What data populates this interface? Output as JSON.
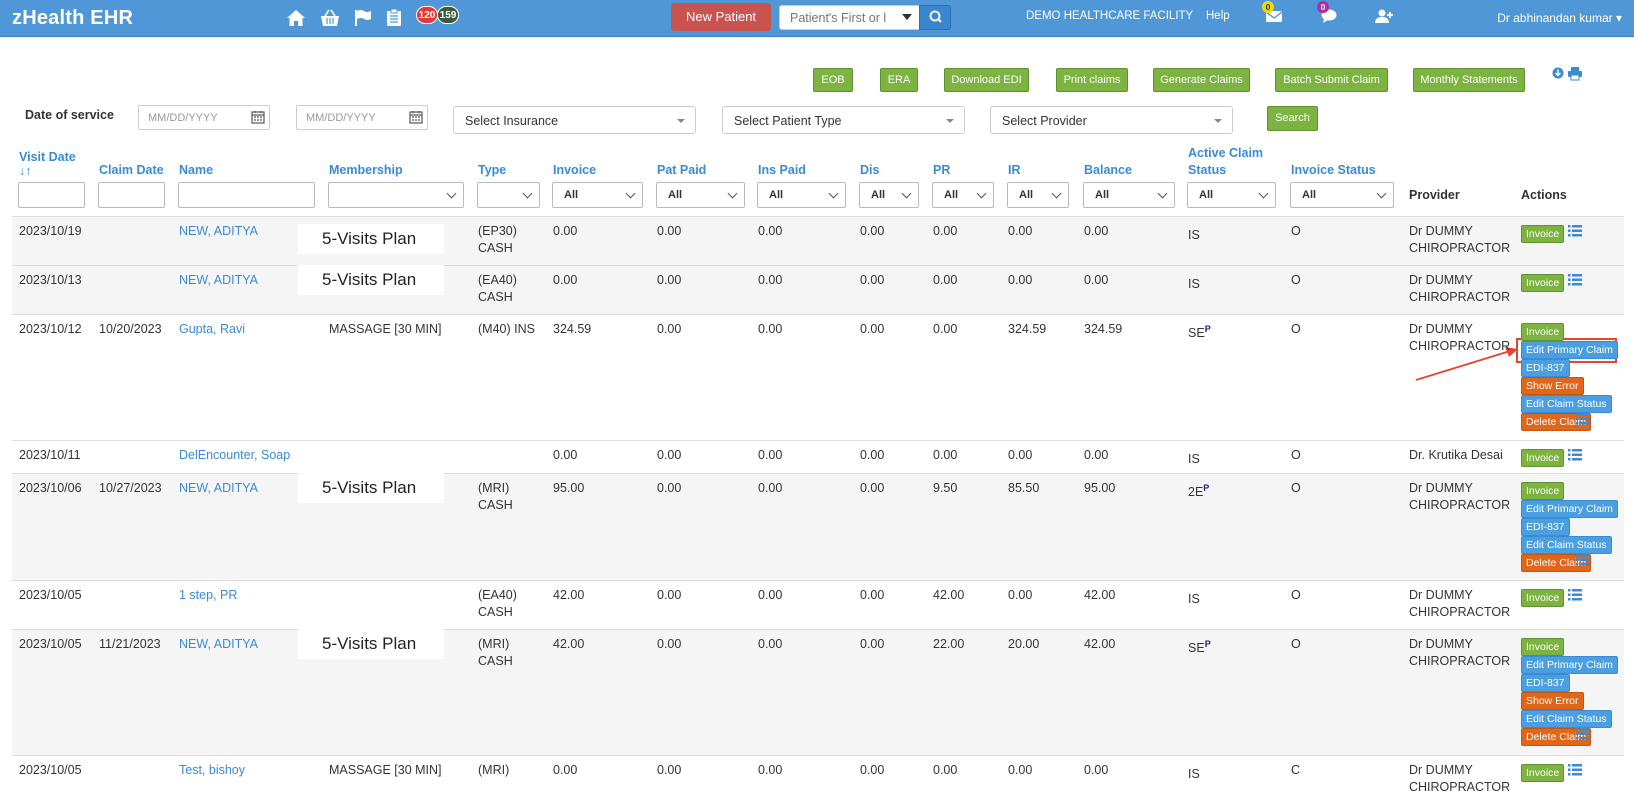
{
  "app": {
    "title": "zHealth EHR"
  },
  "nav": {
    "badges": {
      "red": "120",
      "dark": "159"
    },
    "new_patient": "New Patient",
    "search_placeholder": "Patient's First or l",
    "facility": "DEMO HEALTHCARE FACILITY",
    "help": "Help",
    "mail_count": "0",
    "chat_count": "0",
    "user": "Dr abhinandan kumar"
  },
  "toolbar": {
    "eob": "EOB",
    "era": "ERA",
    "download_edi": "Download EDI",
    "print_claims": "Print claims",
    "generate_claims": "Generate Claims",
    "batch_submit": "Batch Submit Claim",
    "monthly_statements": "Monthly Statements"
  },
  "filters": {
    "date_label": "Date of service",
    "date_placeholder": "MM/DD/YYYY",
    "insurance": "Select Insurance",
    "patient_type": "Select Patient Type",
    "provider": "Select Provider",
    "search": "Search"
  },
  "columns": {
    "visit_date": "Visit Date",
    "claim_date": "Claim Date",
    "name": "Name",
    "membership": "Membership",
    "type": "Type",
    "invoice": "Invoice",
    "pat_paid": "Pat Paid",
    "ins_paid": "Ins Paid",
    "dis": "Dis",
    "pr": "PR",
    "ir": "IR",
    "balance": "Balance",
    "active_claim_status": "Active Claim",
    "active_claim_status2": "Status",
    "invoice_status": "Invoice Status",
    "provider": "Provider",
    "actions": "Actions",
    "all": "All"
  },
  "actions": {
    "invoice": "Invoice",
    "edit_primary": "Edit Primary Claim",
    "edi": "EDI-837",
    "show_error": "Show Error",
    "edit_status": "Edit Claim Status",
    "delete": "Delete Claim"
  },
  "rows": [
    {
      "visit": "2023/10/19",
      "claim": "",
      "name": "NEW, ADITYA",
      "membership": "5-Visits Plan",
      "type1": "(EP30)",
      "type2": "CASH",
      "invoice": "0.00",
      "pat": "0.00",
      "ins": "0.00",
      "dis": "0.00",
      "pr": "0.00",
      "ir": "0.00",
      "bal": "0.00",
      "status": "IS",
      "sup": "",
      "inv_status": "O",
      "prov1": "Dr DUMMY",
      "prov2": "CHIROPRACTOR"
    },
    {
      "visit": "2023/10/13",
      "claim": "",
      "name": "NEW, ADITYA",
      "membership": "5-Visits Plan",
      "type1": "(EA40)",
      "type2": "CASH",
      "invoice": "0.00",
      "pat": "0.00",
      "ins": "0.00",
      "dis": "0.00",
      "pr": "0.00",
      "ir": "0.00",
      "bal": "0.00",
      "status": "IS",
      "sup": "",
      "inv_status": "O",
      "prov1": "Dr DUMMY",
      "prov2": "CHIROPRACTOR"
    },
    {
      "visit": "2023/10/12",
      "claim": "10/20/2023",
      "name": "Gupta, Ravi",
      "membership": "MASSAGE [30 MIN]",
      "type1": "(M40) INS",
      "type2": "",
      "invoice": "324.59",
      "pat": "0.00",
      "ins": "0.00",
      "dis": "0.00",
      "pr": "0.00",
      "ir": "324.59",
      "bal": "324.59",
      "status": "SE",
      "sup": "P",
      "inv_status": "O",
      "prov1": "Dr DUMMY",
      "prov2": "CHIROPRACTOR"
    },
    {
      "visit": "2023/10/11",
      "claim": "",
      "name": "DelEncounter, Soap",
      "membership": "",
      "type1": "",
      "type2": "",
      "invoice": "0.00",
      "pat": "0.00",
      "ins": "0.00",
      "dis": "0.00",
      "pr": "0.00",
      "ir": "0.00",
      "bal": "0.00",
      "status": "IS",
      "sup": "",
      "inv_status": "O",
      "prov1": "Dr. Krutika Desai",
      "prov2": ""
    },
    {
      "visit": "2023/10/06",
      "claim": "10/27/2023",
      "name": "NEW, ADITYA",
      "membership": "5-Visits Plan",
      "type1": "(MRI)",
      "type2": "CASH",
      "invoice": "95.00",
      "pat": "0.00",
      "ins": "0.00",
      "dis": "0.00",
      "pr": "9.50",
      "ir": "85.50",
      "bal": "95.00",
      "status": "2E",
      "sup": "P",
      "inv_status": "O",
      "prov1": "Dr DUMMY",
      "prov2": "CHIROPRACTOR"
    },
    {
      "visit": "2023/10/05",
      "claim": "",
      "name": "1 step, PR",
      "membership": "",
      "type1": "(EA40)",
      "type2": "CASH",
      "invoice": "42.00",
      "pat": "0.00",
      "ins": "0.00",
      "dis": "0.00",
      "pr": "42.00",
      "ir": "0.00",
      "bal": "42.00",
      "status": "IS",
      "sup": "",
      "inv_status": "O",
      "prov1": "Dr DUMMY",
      "prov2": "CHIROPRACTOR"
    },
    {
      "visit": "2023/10/05",
      "claim": "11/21/2023",
      "name": "NEW, ADITYA",
      "membership": "5-Visits Plan",
      "type1": "(MRI)",
      "type2": "CASH",
      "invoice": "42.00",
      "pat": "0.00",
      "ins": "0.00",
      "dis": "0.00",
      "pr": "22.00",
      "ir": "20.00",
      "bal": "42.00",
      "status": "SE",
      "sup": "P",
      "inv_status": "O",
      "prov1": "Dr DUMMY",
      "prov2": "CHIROPRACTOR"
    },
    {
      "visit": "2023/10/05",
      "claim": "",
      "name": "Test, bishoy",
      "membership": "MASSAGE [30 MIN]",
      "type1": "(MRI)",
      "type2": "",
      "invoice": "0.00",
      "pat": "0.00",
      "ins": "0.00",
      "dis": "0.00",
      "pr": "0.00",
      "ir": "0.00",
      "bal": "0.00",
      "status": "IS",
      "sup": "",
      "inv_status": "C",
      "prov1": "Dr DUMMY",
      "prov2": "CHIROPRACTOR"
    }
  ]
}
